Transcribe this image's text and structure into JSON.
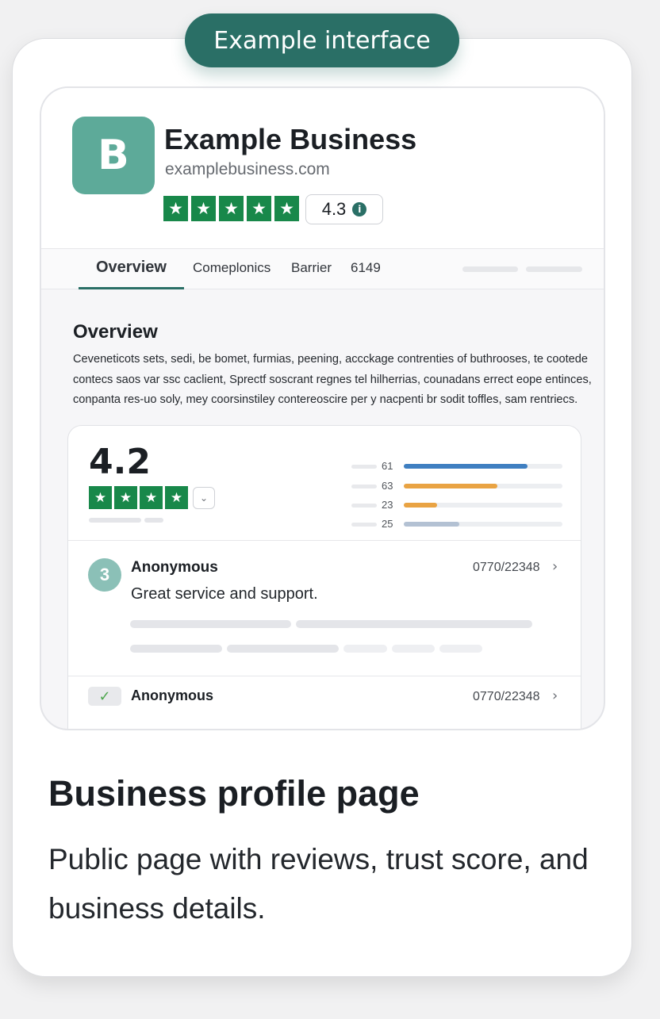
{
  "badge": "Example interface",
  "business": {
    "logo_letter": "B",
    "name": "Example Business",
    "url": "examplebusiness.com",
    "star_count": 5,
    "rating": "4.3",
    "info_icon": "info-icon"
  },
  "tabs": [
    {
      "label": "Overview",
      "active": true
    },
    {
      "label": "Comeplonics",
      "active": false
    },
    {
      "label": "Barrier",
      "active": false
    },
    {
      "label": "6149",
      "active": false
    }
  ],
  "overview": {
    "title": "Overview",
    "body": "Ceveneticots sets, sedi, be bomet, furmias, peening, accckage contrenties of buthrooses, te cootede contecs saos var ssc caclient, Sprectf soscrant regnes tel hilherrias, counadans errect eope entinces, conpanta res-uo soly, mey coorsinstiley contereoscire per y nacpenti br sodit toffles, sam rentriecs."
  },
  "summary": {
    "score": "4.2",
    "star_count": 4,
    "distribution": [
      {
        "count": "61",
        "fraction": 0.78,
        "color": "#3f7fc1"
      },
      {
        "count": "63",
        "fraction": 0.59,
        "color": "#e9a343"
      },
      {
        "count": "23",
        "fraction": 0.21,
        "color": "#e9a343"
      },
      {
        "count": "25",
        "fraction": 0.35,
        "color": "#b3c1d3"
      }
    ]
  },
  "reviews": [
    {
      "avatar": "3",
      "name": "Anonymous",
      "date": "0770/22348",
      "text": "Great service and support."
    },
    {
      "name": "Anonymous",
      "date": "0770/22348",
      "verified_icon": "checkmark-icon"
    }
  ],
  "footer": {
    "title": "Business profile page",
    "description": "Public page with reviews, trust score, and business details."
  },
  "colors": {
    "accent": "#2a6f66",
    "logo": "#5daa99",
    "star_green": "#18884a"
  }
}
